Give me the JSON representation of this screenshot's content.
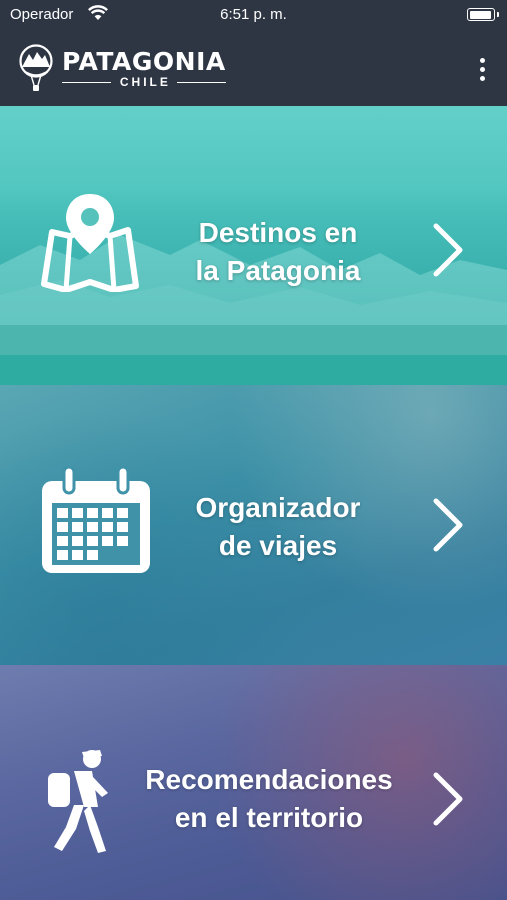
{
  "status_bar": {
    "carrier": "Operador",
    "time": "6:51 p. m."
  },
  "header": {
    "logo_title": "PATAGONIA",
    "logo_subtitle": "CHILE",
    "menu_icon": "vertical-ellipsis-icon"
  },
  "tiles": [
    {
      "line1": "Destinos en",
      "line2": "la Patagonia",
      "icon": "map-pin-icon",
      "color": "#4fbcb6"
    },
    {
      "line1": "Organizador",
      "line2": "de viajes",
      "icon": "calendar-icon",
      "color": "#3a8ea5"
    },
    {
      "line1": "Recomendaciones",
      "line2": "en el territorio",
      "icon": "hiker-icon",
      "color": "#55629c"
    }
  ]
}
